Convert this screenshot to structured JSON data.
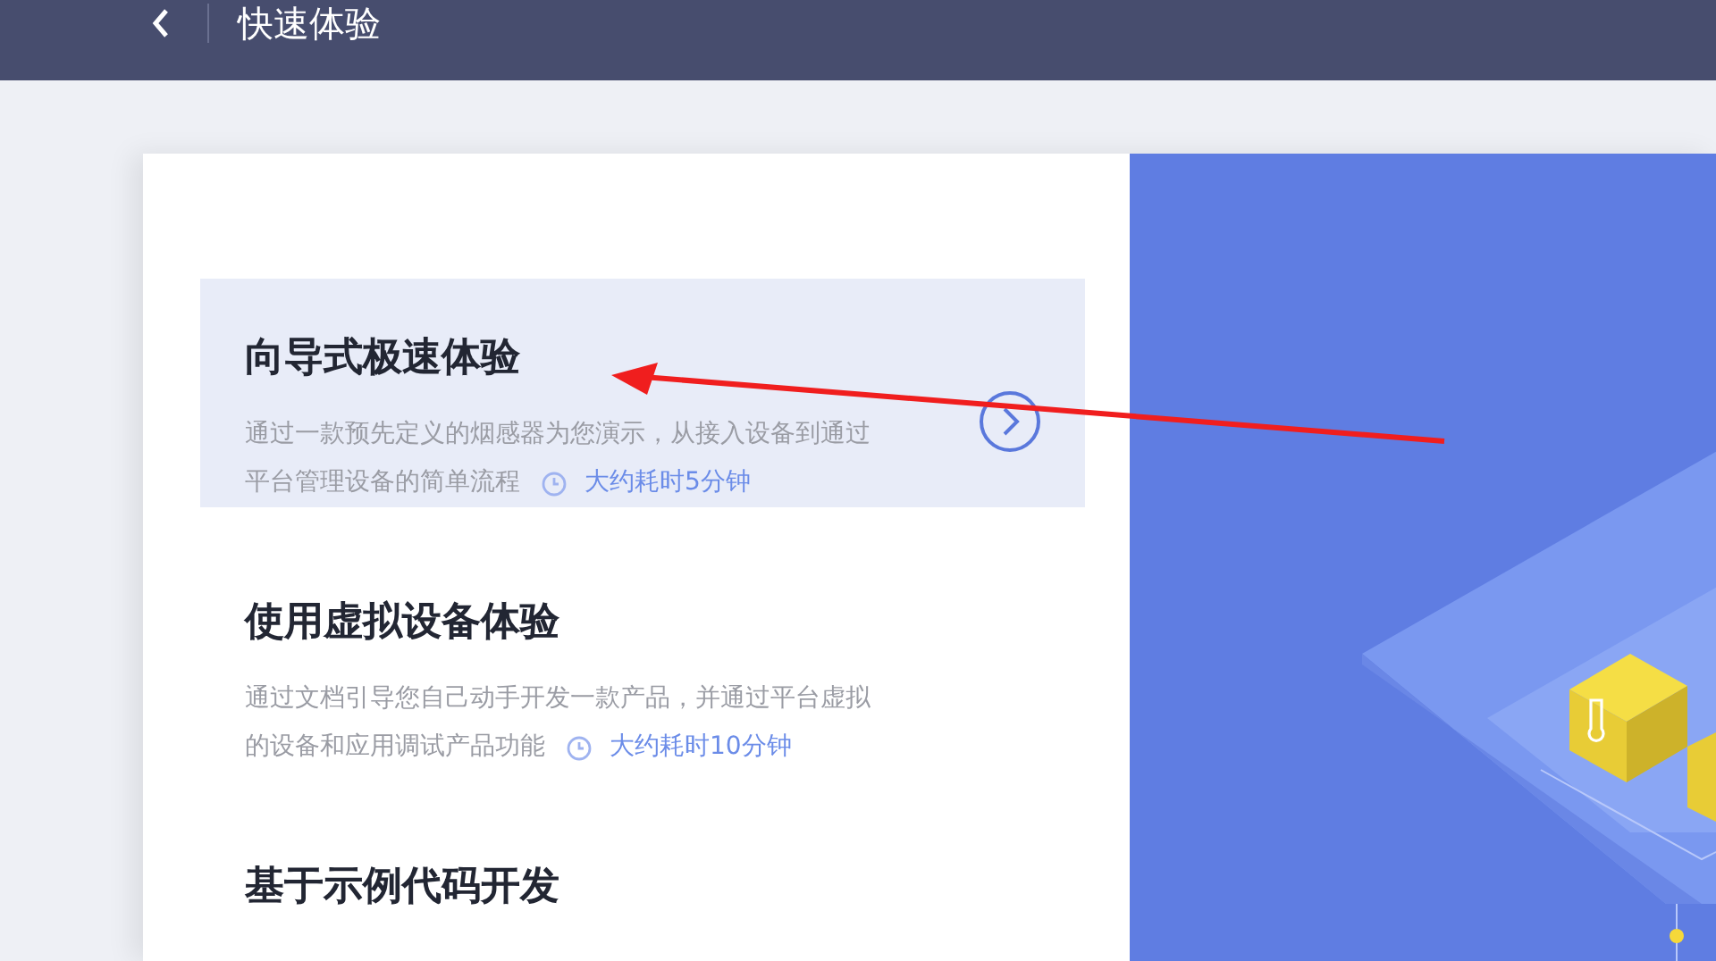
{
  "header": {
    "title": "快速体验"
  },
  "experiences": [
    {
      "title": "向导式极速体验",
      "description_lines": [
        "通过一款预先定义的烟感器为您演示，从接入设备到通过",
        "平台管理设备的简单流程"
      ],
      "duration": "大约耗时5分钟",
      "selected": true
    },
    {
      "title": "使用虚拟设备体验",
      "description_lines": [
        "通过文档引导您自己动手开发一款产品，并通过平台虚拟",
        "的设备和应用调试产品功能"
      ],
      "duration": "大约耗时10分钟",
      "selected": false
    },
    {
      "title": "基于示例代码开发",
      "selected": false
    }
  ]
}
